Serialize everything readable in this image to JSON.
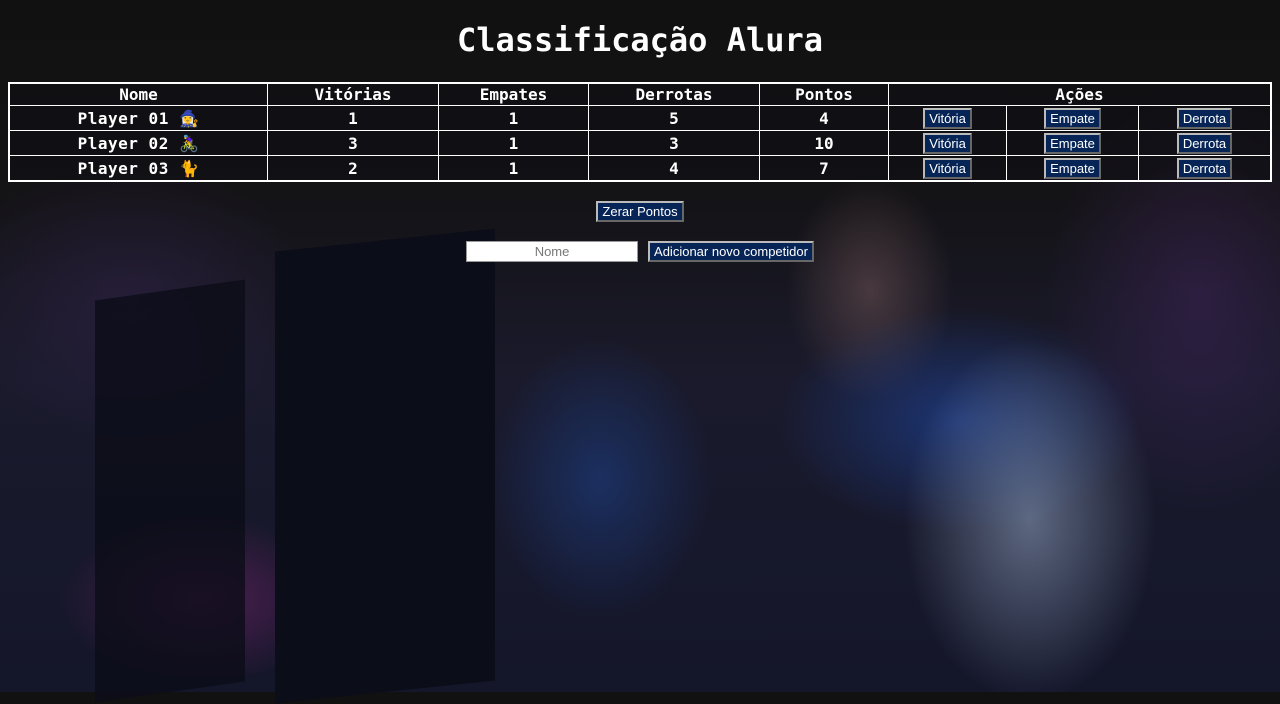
{
  "title": "Classificação Alura",
  "table": {
    "headers": [
      "Nome",
      "Vitórias",
      "Empates",
      "Derrotas",
      "Pontos",
      "Ações"
    ],
    "rows": [
      {
        "name": "Player 01 🧙‍♀️",
        "vitorias": "1",
        "empates": "1",
        "derrotas": "5",
        "pontos": "4"
      },
      {
        "name": "Player 02 🚴‍♀️",
        "vitorias": "3",
        "empates": "1",
        "derrotas": "3",
        "pontos": "10"
      },
      {
        "name": "Player 03 🐈",
        "vitorias": "2",
        "empates": "1",
        "derrotas": "4",
        "pontos": "7"
      }
    ],
    "actions": {
      "win": "Vitória",
      "draw": "Empate",
      "loss": "Derrota"
    }
  },
  "reset_label": "Zerar Pontos",
  "new_player": {
    "placeholder": "Nome",
    "add_label": "Adicionar novo competidor"
  }
}
